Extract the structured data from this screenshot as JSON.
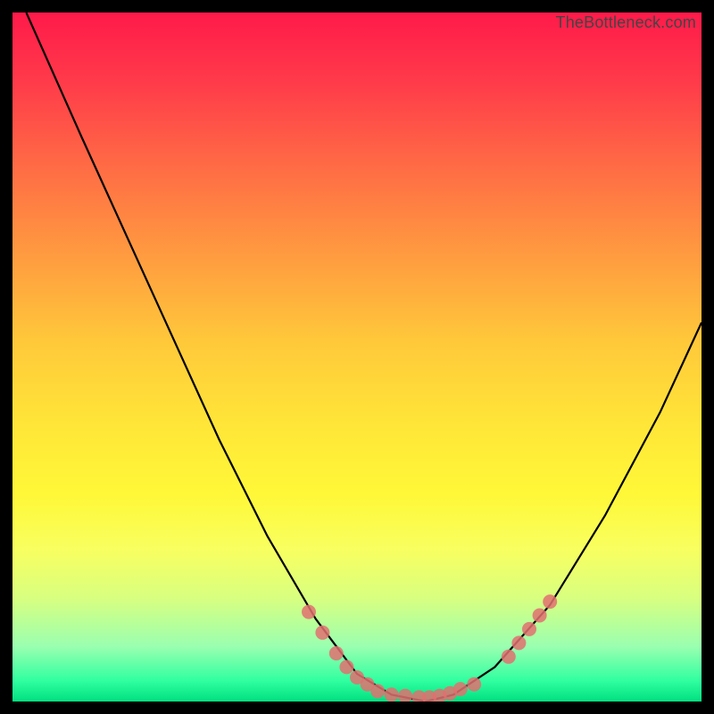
{
  "watermark": "TheBottleneck.com",
  "chart_data": {
    "type": "line",
    "title": "",
    "xlabel": "",
    "ylabel": "",
    "xlim": [
      0,
      100
    ],
    "ylim": [
      0,
      100
    ],
    "grid": false,
    "legend": false,
    "series": [
      {
        "name": "bottleneck-curve",
        "color": "#000000",
        "x": [
          2,
          10,
          20,
          30,
          37,
          44,
          50,
          55,
          60,
          64,
          70,
          78,
          86,
          94,
          100
        ],
        "y": [
          100,
          82,
          60,
          38,
          24,
          12,
          4,
          1,
          0,
          1,
          5,
          14,
          27,
          42,
          55
        ]
      },
      {
        "name": "highlight-points-left",
        "type": "scatter",
        "color": "#e27070",
        "x": [
          43,
          45,
          47,
          48.5,
          50,
          51.5
        ],
        "y": [
          13,
          10,
          7,
          5,
          3.5,
          2.5
        ]
      },
      {
        "name": "highlight-points-bottom",
        "type": "scatter",
        "color": "#e27070",
        "x": [
          53,
          55,
          57,
          59,
          60.5,
          62,
          63.5,
          65,
          67
        ],
        "y": [
          1.5,
          1,
          0.8,
          0.6,
          0.6,
          0.8,
          1.2,
          1.8,
          2.5
        ]
      },
      {
        "name": "highlight-points-right",
        "type": "scatter",
        "color": "#e27070",
        "x": [
          72,
          73.5,
          75,
          76.5,
          78
        ],
        "y": [
          6.5,
          8.5,
          10.5,
          12.5,
          14.5
        ]
      }
    ],
    "background_gradient": {
      "direction": "vertical",
      "stops": [
        {
          "pos": 0,
          "color": "#ff1a4a"
        },
        {
          "pos": 35,
          "color": "#ff9a40"
        },
        {
          "pos": 60,
          "color": "#ffe638"
        },
        {
          "pos": 85,
          "color": "#d8ff80"
        },
        {
          "pos": 100,
          "color": "#00e080"
        }
      ]
    }
  }
}
